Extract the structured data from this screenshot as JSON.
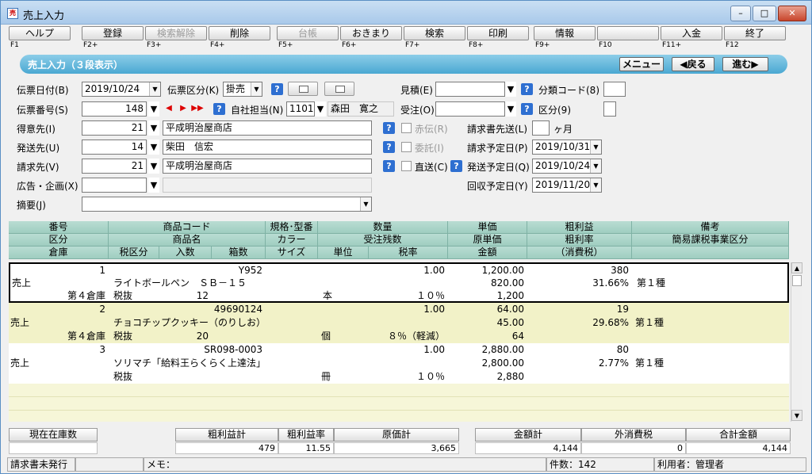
{
  "window": {
    "title": "売上入力",
    "app_icon_text": "売"
  },
  "fkeys": [
    {
      "label": "ヘルプ",
      "key": "F1",
      "enabled": true
    },
    {
      "label": "登録",
      "key": "F2+",
      "enabled": true
    },
    {
      "label": "検索解除",
      "key": "F3+",
      "enabled": false
    },
    {
      "label": "削除",
      "key": "F4+",
      "enabled": true
    },
    {
      "label": "台帳",
      "key": "F5+",
      "enabled": false
    },
    {
      "label": "おきまり",
      "key": "F6+",
      "enabled": true
    },
    {
      "label": "検索",
      "key": "F7+",
      "enabled": true
    },
    {
      "label": "印刷",
      "key": "F8+",
      "enabled": true
    },
    {
      "label": "情報",
      "key": "F9+",
      "enabled": true
    },
    {
      "label": "",
      "key": "F10",
      "enabled": true
    },
    {
      "label": "入金",
      "key": "F11+",
      "enabled": true
    },
    {
      "label": "終了",
      "key": "F12",
      "enabled": true
    }
  ],
  "band": {
    "title": "売上入力（３段表示）",
    "menu": "メニュー",
    "back": "◀戻る",
    "next": "進む▶"
  },
  "form": {
    "denpyo_date_label": "伝票日付(B)",
    "denpyo_date": "2019/10/24",
    "denpyo_kubun_label": "伝票区分(K)",
    "denpyo_kubun": "掛売",
    "mitsumori_label": "見積(E)",
    "mitsumori": "",
    "bunrui_label": "分類コード(8)",
    "bunrui": "",
    "denpyo_no_label": "伝票番号(S)",
    "denpyo_no": "148",
    "tanto_label": "自社担当(N)",
    "tanto_code": "1101",
    "tanto_name": "森田　寛之",
    "juchu_label": "受注(O)",
    "juchu": "",
    "kubun_label": "区分(9)",
    "kubun": "",
    "tokui_label": "得意先(I)",
    "tokui_code": "21",
    "tokui_name": "平成明治屋商店",
    "akaden_label": "赤伝(R)",
    "seikyu_saki_label": "請求書先送(L)",
    "seikyu_saki": "",
    "month_unit": "ヶ月",
    "hasso_label": "発送先(U)",
    "hasso_code": "14",
    "hasso_name": "柴田　信宏",
    "itaku_label": "委託(I)",
    "seikyu_yotei_label": "請求予定日(P)",
    "seikyu_yotei": "2019/10/31",
    "seikyusaki_label": "請求先(V)",
    "seikyusaki_code": "21",
    "seikyusaki_name": "平成明治屋商店",
    "chokuso_label": "直送(C)",
    "hasso_yotei_label": "発送予定日(Q)",
    "hasso_yotei": "2019/10/24",
    "kokoku_label": "広告・企画(X)",
    "kokoku": "",
    "kaishu_label": "回収予定日(Y)",
    "kaishu": "2019/11/20",
    "tekiyo_label": "摘要(J)",
    "tekiyo": ""
  },
  "grid_headers": {
    "row1": [
      "番号",
      "商品コード",
      "規格･型番",
      "数量",
      "単価",
      "粗利益",
      "備考"
    ],
    "row2": [
      "区分",
      "商品名",
      "カラー",
      "受注残数",
      "原単価",
      "粗利率",
      "簡易課税事業区分"
    ],
    "row3": [
      "倉庫",
      "税区分",
      "入数",
      "箱数",
      "サイズ",
      "単位",
      "税率",
      "金額",
      "（消費税）"
    ]
  },
  "rows": [
    {
      "no": "1",
      "code": "Y952",
      "qty": "1.00",
      "price": "1,200.00",
      "profit": "380",
      "kubun": "売上",
      "name": "ライトボールペン　ＳＢ－１５",
      "cost": "820.00",
      "rate": "31.66%",
      "biko": "第１種",
      "soko": "第４倉庫",
      "tax_kubun": "税抜",
      "irisu": "12",
      "unit": "本",
      "tax_rate": "１０％",
      "amount": "1,200"
    },
    {
      "no": "2",
      "code": "49690124",
      "qty": "1.00",
      "price": "64.00",
      "profit": "19",
      "kubun": "売上",
      "name": "チョコチップクッキー（のりしお）",
      "cost": "45.00",
      "rate": "29.68%",
      "biko": "第１種",
      "soko": "第４倉庫",
      "tax_kubun": "税抜",
      "irisu": "20",
      "unit": "個",
      "tax_rate": "８％（軽減）",
      "amount": "64"
    },
    {
      "no": "3",
      "code": "SR098-0003",
      "qty": "1.00",
      "price": "2,880.00",
      "profit": "80",
      "kubun": "売上",
      "name": "ソリマチ「給料王らくらく上達法」",
      "cost": "2,800.00",
      "rate": "2.77%",
      "biko": "第１種",
      "soko": "",
      "tax_kubun": "税抜",
      "irisu": "",
      "unit": "冊",
      "tax_rate": "１０％",
      "amount": "2,880"
    }
  ],
  "totals": {
    "zaiko_label": "現在在庫数",
    "arari_label": "粗利益計",
    "arari": "479",
    "arariritsu_label": "粗利益率",
    "arariritsu": "11.55",
    "genka_label": "原価計",
    "genka": "3,665",
    "kingaku_label": "金額計",
    "kingaku": "4,144",
    "sotozei_label": "外消費税",
    "sotozei": "0",
    "gokei_label": "合計金額",
    "gokei": "4,144"
  },
  "status": {
    "invoice": "請求書未発行",
    "memo": "メモ：",
    "count": "件数：142",
    "user": "利用者：管理者"
  }
}
